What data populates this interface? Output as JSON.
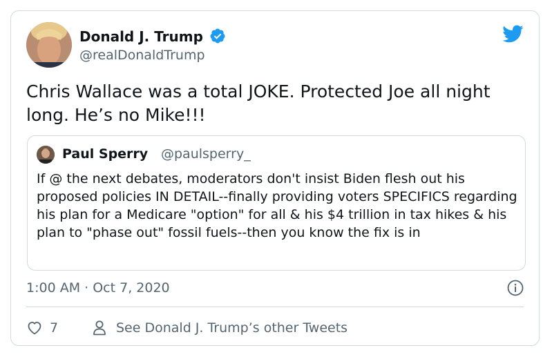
{
  "tweet": {
    "author_name": "Donald J. Trump",
    "author_handle": "@realDonaldTrump",
    "text": "Chris Wallace was a total JOKE. Protected Joe all night long. He’s no Mike!!!",
    "timestamp": "1:00 AM · Oct 7, 2020",
    "likes": "7",
    "other_tweets_label": "See Donald J. Trump’s other Tweets"
  },
  "quoted": {
    "author_name": "Paul Sperry",
    "author_handle": "@paulsperry_",
    "text": "If @ the next debates, moderators don't insist Biden flesh out his proposed policies IN DETAIL--finally providing voters SPECIFICS regarding his plan for a Medicare \"option\" for all & his $4 trillion in tax hikes & his plan to \"phase out\" fossil fuels--then you know the fix is in"
  },
  "colors": {
    "brand_blue": "#1d9bf0",
    "text_primary": "#0f1419",
    "text_secondary": "#536471",
    "border": "#cfd9de"
  },
  "icons": {
    "verified": "verified-badge-icon",
    "bird": "twitter-bird-icon",
    "info": "info-icon",
    "like": "heart-icon",
    "profile": "person-icon"
  }
}
